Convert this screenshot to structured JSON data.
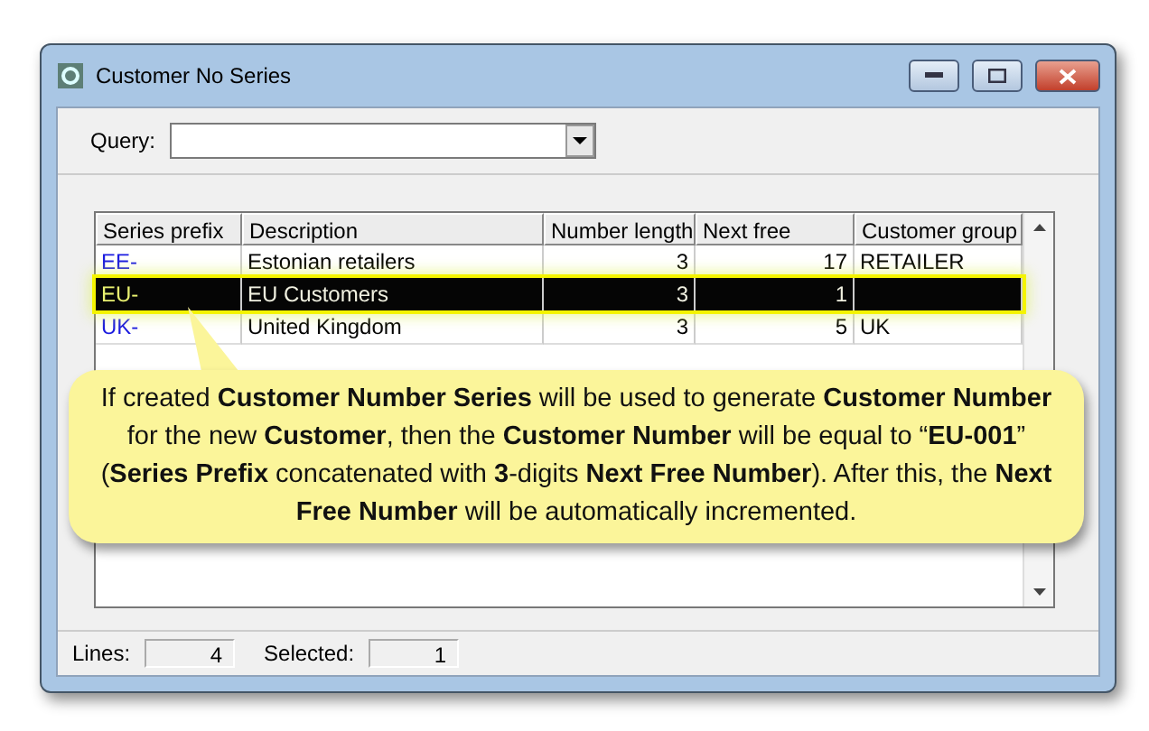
{
  "window": {
    "title": "Customer No Series"
  },
  "query": {
    "label": "Query:"
  },
  "table": {
    "columns": [
      "Series prefix",
      "Description",
      "Number length",
      "Next free",
      "Customer group"
    ],
    "rows": [
      {
        "selected": false,
        "cells": [
          "EE-",
          "Estonian retailers",
          "3",
          "17",
          "RETAILER"
        ]
      },
      {
        "selected": true,
        "cells": [
          "EU-",
          "EU Customers",
          "3",
          "1",
          ""
        ]
      },
      {
        "selected": false,
        "cells": [
          "UK-",
          "United Kingdom",
          "3",
          "5",
          "UK"
        ]
      }
    ]
  },
  "callout": "If created **Customer Number Series** will be used to generate **Customer Number** for the new **Customer**, then the **Customer Number** will be equal to “**EU-001**” (**Series Prefix** concatenated with **3**-digits **Next Free Number**). After this, the **Next Free Number** will be automatically incremented.",
  "status": [
    {
      "label": "Lines:",
      "value": "4"
    },
    {
      "label": "Selected:",
      "value": "1"
    }
  ]
}
